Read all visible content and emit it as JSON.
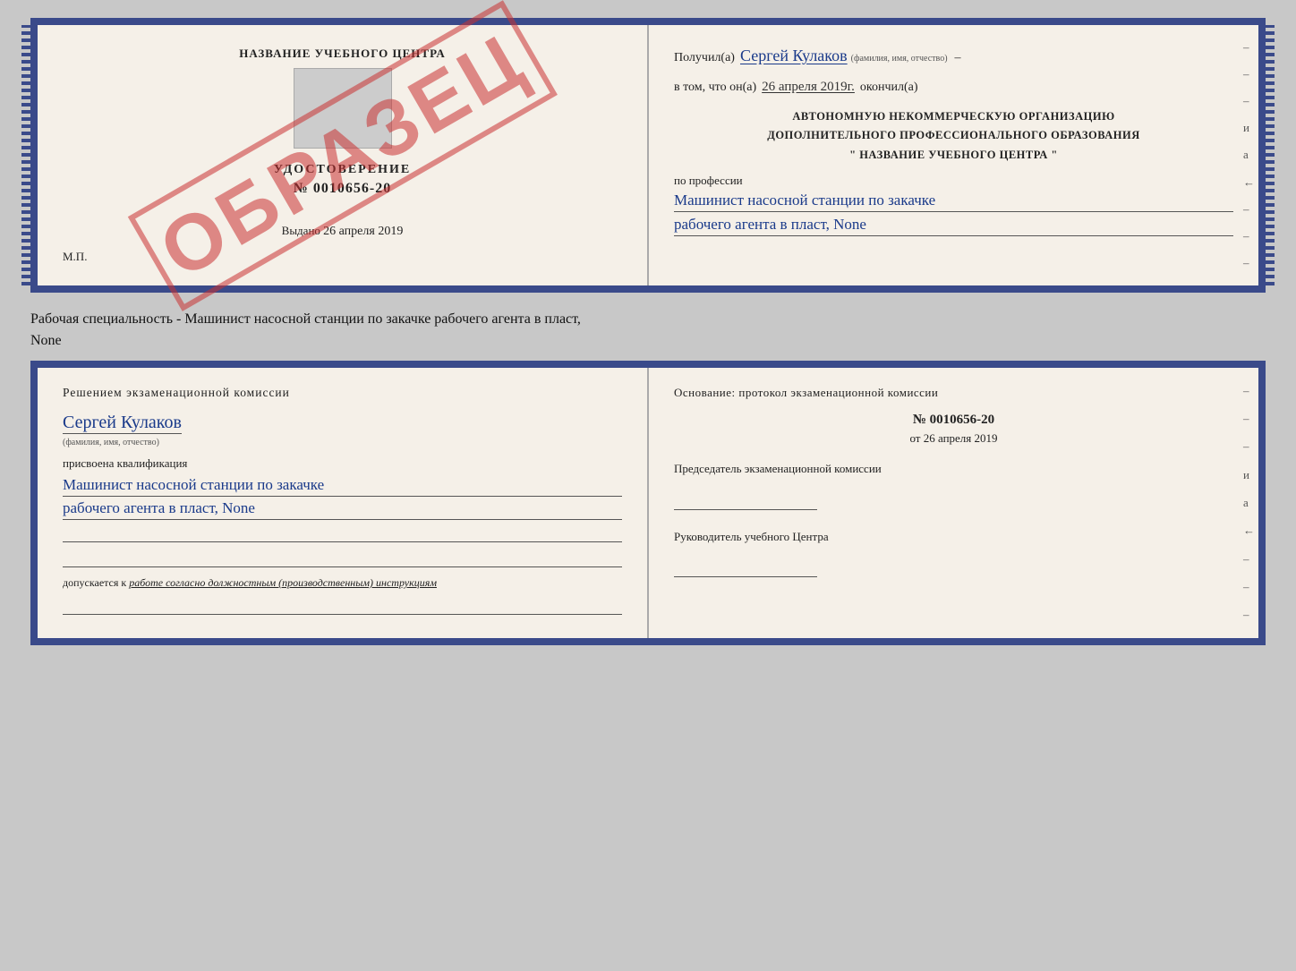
{
  "cert_top": {
    "left": {
      "logo_title": "НАЗВАНИЕ УЧЕБНОГО ЦЕНТРА",
      "watermark": "ОБРАЗЕЦ",
      "cert_heading": "УДОСТОВЕРЕНИЕ",
      "cert_number": "№ 0010656-20",
      "issued_label": "Выдано",
      "issued_date": "26 апреля 2019",
      "mp_label": "М.П."
    },
    "right": {
      "recipient_label": "Получил(а)",
      "recipient_name": "Сергей Кулаков",
      "recipient_sublabel": "(фамилия, имя, отчество)",
      "date_label": "в том, что он(а)",
      "date_value": "26 апреля 2019г.",
      "okончил_label": "окончил(а)",
      "org_line1": "АВТОНОМНУЮ НЕКОММЕРЧЕСКУЮ ОРГАНИЗАЦИЮ",
      "org_line2": "ДОПОЛНИТЕЛЬНОГО ПРОФЕССИОНАЛЬНОГО ОБРАЗОВАНИЯ",
      "org_line3": "\" НАЗВАНИЕ УЧЕБНОГО ЦЕНТРА \"",
      "profession_label": "по профессии",
      "profession_line1": "Машинист насосной станции по закачке",
      "profession_line2": "рабочего агента в пласт, None",
      "dashes": [
        "-",
        "-",
        "-",
        "и",
        "а",
        "←",
        "-",
        "-",
        "-"
      ]
    }
  },
  "label_between": {
    "line1": "Рабочая специальность - Машинист насосной станции по закачке рабочего агента в пласт,",
    "line2": "None"
  },
  "cert_bottom": {
    "left": {
      "commission_title": "Решением экзаменационной комиссии",
      "name": "Сергей Кулаков",
      "name_sublabel": "(фамилия, имя, отчество)",
      "assigned_label": "присвоена квалификация",
      "qualification_line1": "Машинист насосной станции по закачке",
      "qualification_line2": "рабочего агента в пласт, None",
      "допускается_label": "допускается к",
      "допускается_value": "работе согласно должностным (производственным) инструкциям"
    },
    "right": {
      "reason_title": "Основание: протокол экзаменационной комиссии",
      "protocol_number": "№ 0010656-20",
      "protocol_date_prefix": "от",
      "protocol_date": "26 апреля 2019",
      "chairman_label": "Председатель экзаменационной комиссии",
      "head_label": "Руководитель учебного Центра",
      "dashes": [
        "-",
        "-",
        "-",
        "и",
        "а",
        "←",
        "-",
        "-",
        "-"
      ]
    }
  }
}
